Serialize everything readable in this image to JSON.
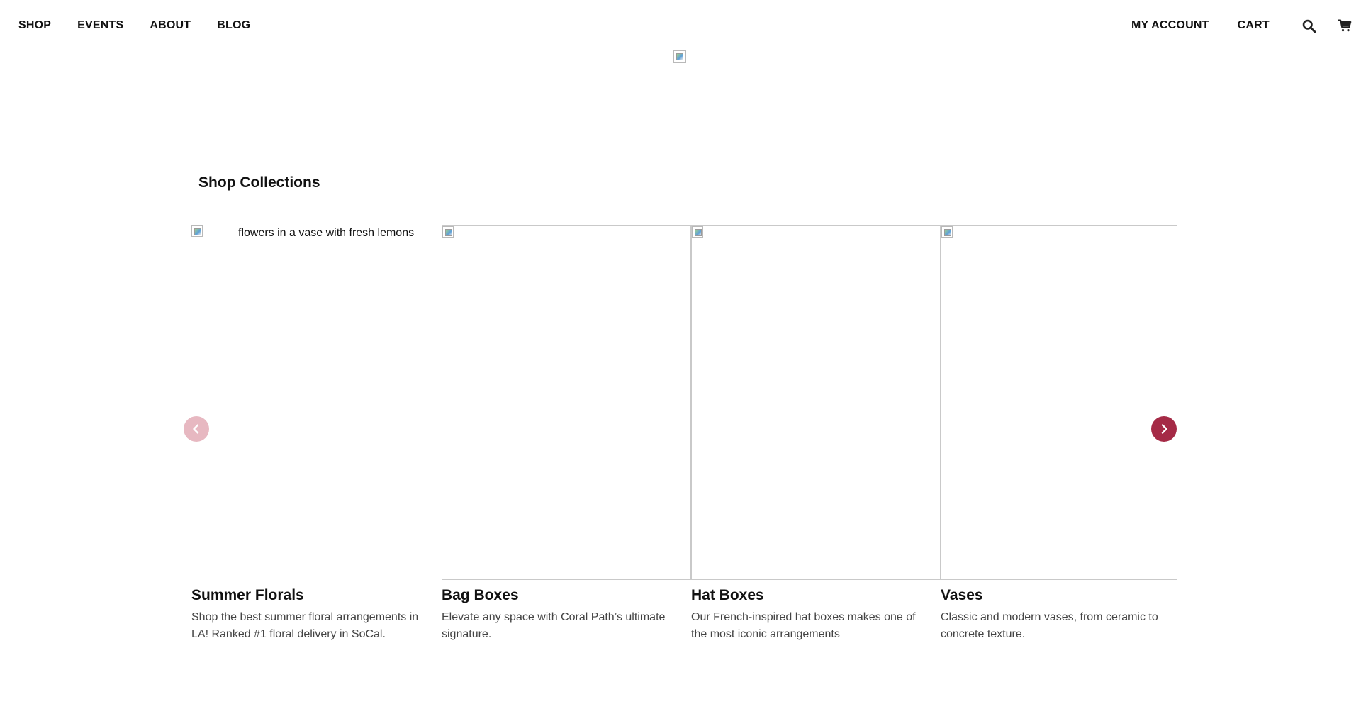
{
  "nav": {
    "left": [
      "SHOP",
      "EVENTS",
      "ABOUT",
      "BLOG"
    ],
    "my_account": "MY ACCOUNT",
    "cart": "CART",
    "search_icon": "search-icon",
    "cart_icon": "shopping-cart-icon"
  },
  "logo": {
    "state": "broken-image"
  },
  "section": {
    "title": "Shop Collections"
  },
  "collections": [
    {
      "image_alt": "flowers in a vase with fresh lemons",
      "title": "Summer Florals",
      "description": "Shop the best summer floral arrangements in LA! Ranked #1 floral delivery in SoCal."
    },
    {
      "image_alt": "",
      "title": "Bag Boxes",
      "description": "Elevate any space with Coral Path’s ultimate signature."
    },
    {
      "image_alt": "",
      "title": "Hat Boxes",
      "description": "Our French-inspired hat boxes makes one of the most iconic arrangements"
    },
    {
      "image_alt": "",
      "title": "Vases",
      "description": "Classic and modern vases, from ceramic to concrete texture."
    }
  ],
  "carousel": {
    "prev_icon": "chevron-left-icon",
    "next_icon": "chevron-right-icon",
    "prev_color": "#e7b8c1",
    "next_color": "#a52a46"
  }
}
